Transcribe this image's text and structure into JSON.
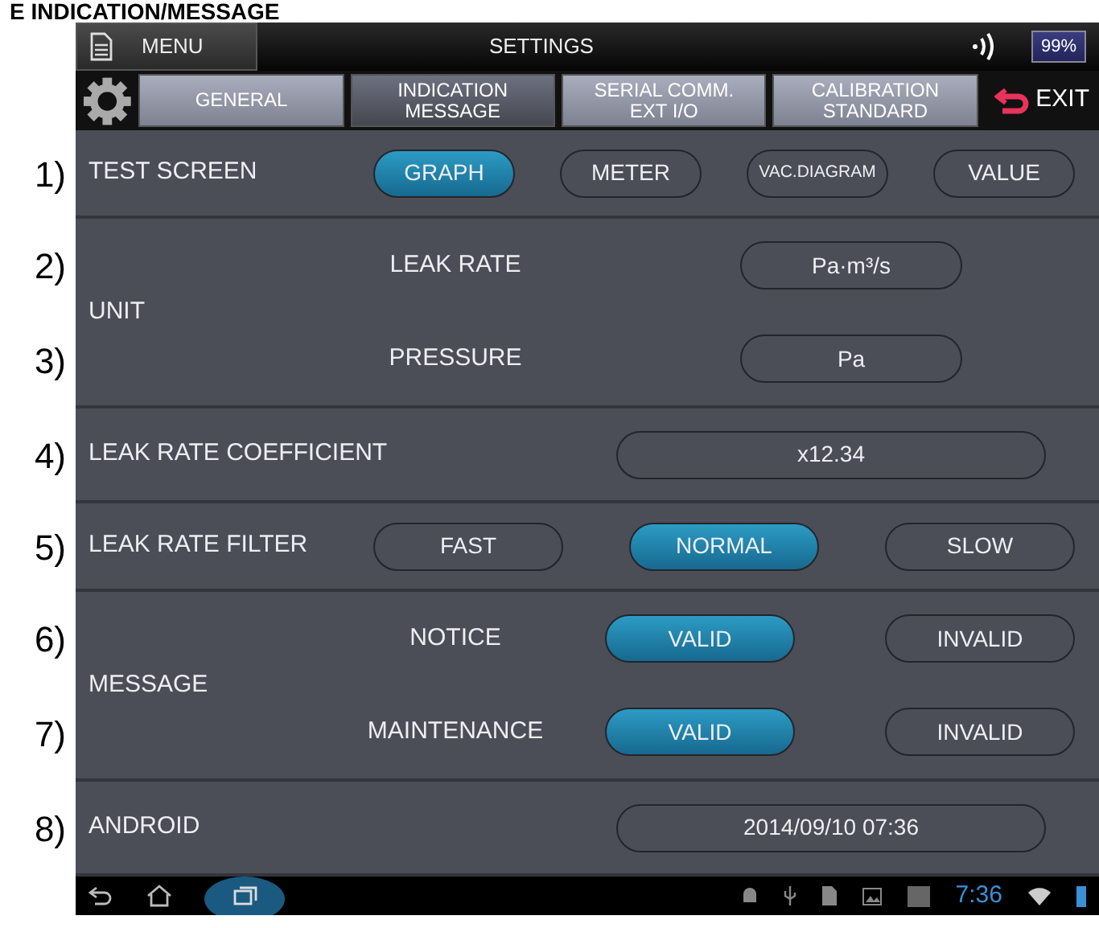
{
  "heading": "E INDICATION/MESSAGE",
  "status_bar": {
    "menu": "MENU",
    "title": "SETTINGS",
    "battery": "99%"
  },
  "tabs": [
    {
      "lines": [
        "GENERAL"
      ],
      "selected": false
    },
    {
      "lines": [
        "INDICATION",
        "MESSAGE"
      ],
      "selected": true
    },
    {
      "lines": [
        "SERIAL COMM.",
        "EXT I/O"
      ],
      "selected": false
    },
    {
      "lines": [
        "CALIBRATION",
        "STANDARD"
      ],
      "selected": false
    }
  ],
  "exit": "EXIT",
  "settings": [
    {
      "kind": "choice",
      "number": "1)",
      "label": "TEST SCREEN",
      "options": [
        {
          "label": "GRAPH",
          "selected": true
        },
        {
          "label": "METER",
          "selected": false
        },
        {
          "label": "VAC.DIAGRAM",
          "selected": false,
          "compact": true
        },
        {
          "label": "VALUE",
          "selected": false
        }
      ]
    },
    {
      "kind": "group",
      "label": "UNIT",
      "items": [
        {
          "kind": "value",
          "number": "2)",
          "label": "LEAK RATE",
          "value": "Pa·m³/s"
        },
        {
          "kind": "value",
          "number": "3)",
          "label": "PRESSURE",
          "value": "Pa"
        }
      ]
    },
    {
      "kind": "value",
      "number": "4)",
      "label": "LEAK RATE COEFFICIENT",
      "value": "x12.34"
    },
    {
      "kind": "choice",
      "number": "5)",
      "label": "LEAK RATE FILTER",
      "options": [
        {
          "label": "FAST",
          "selected": false
        },
        {
          "label": "NORMAL",
          "selected": true
        },
        {
          "label": "SLOW",
          "selected": false
        }
      ]
    },
    {
      "kind": "group",
      "label": "MESSAGE",
      "items": [
        {
          "kind": "choice",
          "number": "6)",
          "label": "NOTICE",
          "options": [
            {
              "label": "VALID",
              "selected": true
            },
            {
              "label": "INVALID",
              "selected": false
            }
          ]
        },
        {
          "kind": "choice",
          "number": "7)",
          "label": "MAINTENANCE",
          "options": [
            {
              "label": "VALID",
              "selected": true
            },
            {
              "label": "INVALID",
              "selected": false
            }
          ]
        }
      ]
    },
    {
      "kind": "value",
      "number": "8)",
      "label": "ANDROID",
      "value": "2014/09/10 07:36"
    }
  ],
  "nav_bar": {
    "clock": "7:36"
  }
}
